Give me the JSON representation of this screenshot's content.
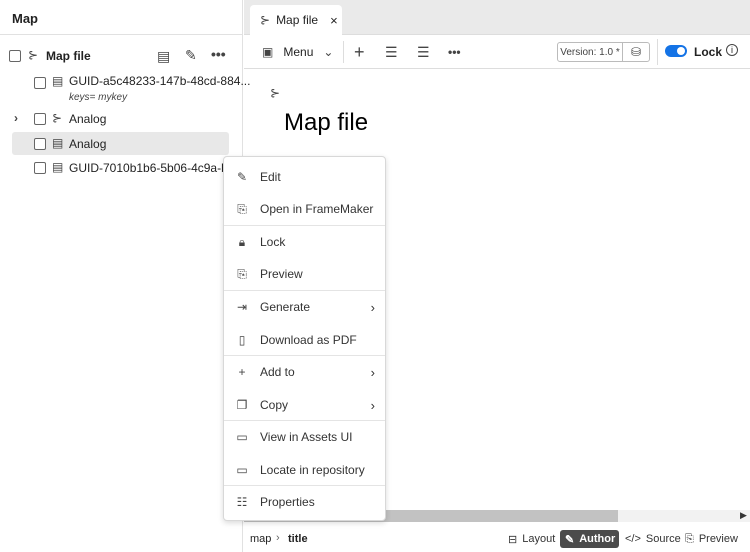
{
  "left_panel": {
    "title": "Map",
    "root": {
      "label": "Map file"
    },
    "items": [
      {
        "label": "GUID-a5c48233-147b-48cd-884...",
        "sub": "keys= mykey"
      },
      {
        "label": "Analog"
      },
      {
        "label": "Analog"
      },
      {
        "label": "GUID-7010b1b6-5b06-4c9a-b3f..."
      }
    ]
  },
  "tab": {
    "label": "Map file",
    "close": "×"
  },
  "toolbar": {
    "menu_label": "Menu",
    "version": "Version: 1.0 *",
    "lock_label": "Lock",
    "lock_on": true
  },
  "editor": {
    "title": "Map file"
  },
  "context_menu": [
    {
      "label": "Edit",
      "icon": "pencil-icon"
    },
    {
      "label": "Open in FrameMaker",
      "icon": "document-search-icon"
    },
    {
      "label": "Lock",
      "icon": "lock-icon"
    },
    {
      "label": "Preview",
      "icon": "preview-icon"
    },
    {
      "label": "Generate",
      "icon": "export-icon",
      "submenu": true
    },
    {
      "label": "Download as PDF",
      "icon": "pdf-icon"
    },
    {
      "label": "Add to",
      "icon": "plus-icon",
      "submenu": true
    },
    {
      "label": "Copy",
      "icon": "copy-icon",
      "submenu": true
    },
    {
      "label": "View in Assets UI",
      "icon": "assets-icon"
    },
    {
      "label": "Locate in repository",
      "icon": "folder-search-icon"
    },
    {
      "label": "Properties",
      "icon": "sliders-icon"
    }
  ],
  "breadcrumb": [
    "map",
    "title"
  ],
  "view_modes": [
    {
      "label": "Layout"
    },
    {
      "label": "Author",
      "active": true
    },
    {
      "label": "Source"
    },
    {
      "label": "Preview"
    }
  ],
  "colors": {
    "accent": "#1473e6",
    "active_mode": "#4b4b4b"
  }
}
